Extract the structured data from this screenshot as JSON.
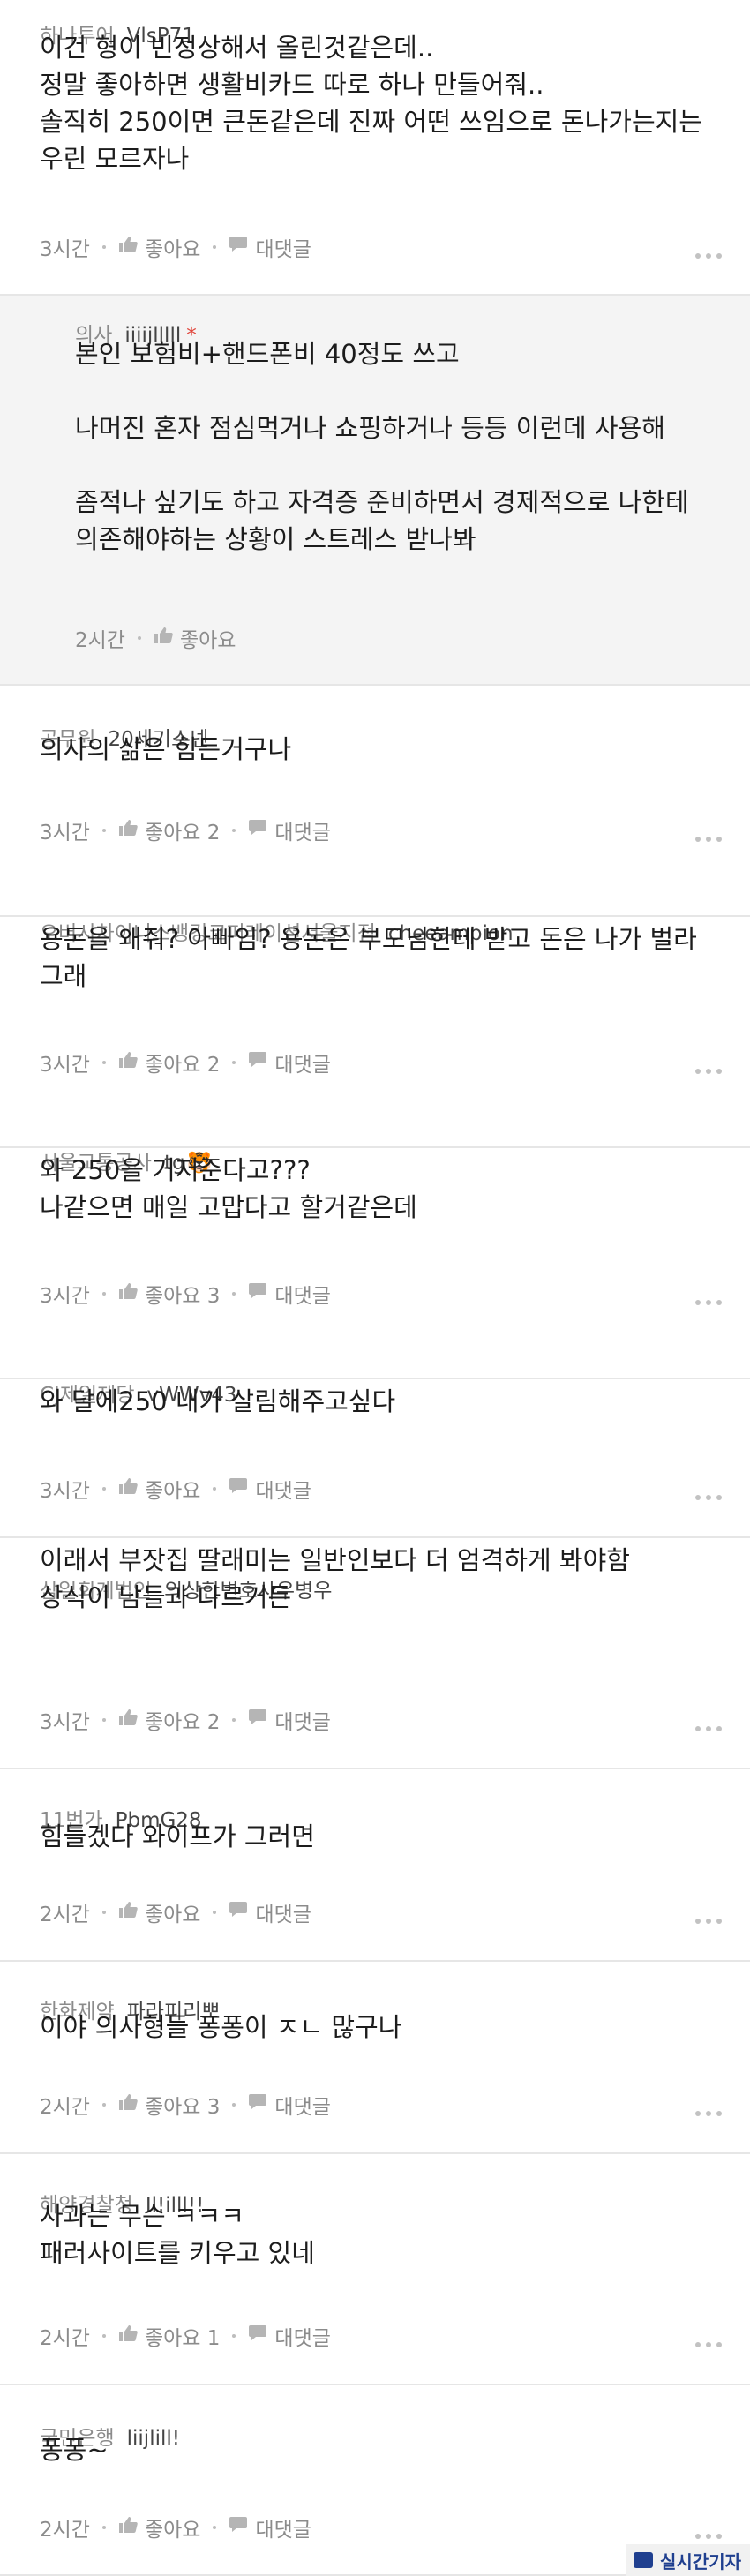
{
  "comments": [
    {
      "org": "하나투어",
      "nick": "VlsP71",
      "lines": [
        "이건 형이 빈정상해서 올린것같은데..",
        "정말 좋아하면 생활비카드 따로 하나 만들어줘..",
        "솔직히 250이면 큰돈같은데 진짜 어떤 쓰임으로 돈나가는지는",
        "우린 모르자나"
      ],
      "time": "3시간",
      "like": "좋아요",
      "reply": "대댓글"
    },
    {
      "org": "의사",
      "nick": "iiiijlllll",
      "star": "*",
      "lines": [
        "본인 보험비+핸드폰비 40정도 쓰고",
        "",
        "나머진 혼자 점심먹거나 쇼핑하거나 등등 이런데 사용해",
        "",
        "좀적나 싶기도 하고 자격증 준비하면서 경제적으로 나한테",
        "의존해야하는 상황이 스트레스 받나봐"
      ],
      "time": "2시간",
      "like": "좋아요"
    },
    {
      "org": "공무원",
      "nick": "20세기소넨",
      "lines": [
        "의사의 삶은 힘든거구나"
      ],
      "time": "3시간",
      "like": "좋아요 2",
      "reply": "대댓글"
    },
    {
      "org": "오버시차이니스뱅킹코퍼레이션서울지점",
      "nick": "cheeampion",
      "lines": [
        "용돈을 왜줘? 아빠임? 용돈은 부모님한테 받고 돈은 나가 벌라",
        "그래"
      ],
      "time": "3시간",
      "like": "좋아요 2",
      "reply": "대댓글"
    },
    {
      "org": "서울교통공사",
      "nick": "tg",
      "flag": "🐯",
      "lines": [
        "와 250을 거저준다고???",
        "나같으면 매일 고맙다고 할거같은데"
      ],
      "time": "3시간",
      "like": "좋아요 3",
      "reply": "대댓글"
    },
    {
      "org": "CJ제일제당",
      "nick": "vWWv43",
      "lines": [
        "와 달에250 내가 살림해주고싶다"
      ],
      "time": "3시간",
      "like": "좋아요",
      "reply": "대댓글"
    },
    {
      "org": "삼일회계법인",
      "nick": "의상한변호사우병우",
      "lines": [
        "이래서 부잣집 딸래미는 일반인보다 더 엄격하게 봐야함",
        "상식이 남들과 다르거든"
      ],
      "time": "3시간",
      "like": "좋아요 2",
      "reply": "대댓글"
    },
    {
      "org": "11번가",
      "nick": "PbmG28",
      "lines": [
        "힘들겠다 와이프가 그러면"
      ],
      "time": "2시간",
      "like": "좋아요",
      "reply": "대댓글"
    },
    {
      "org": "한화제약",
      "nick": "파라피리뽀",
      "lines": [
        "이야 의사형들 퐁퐁이 ㅈㄴ 많구나"
      ],
      "time": "2시간",
      "like": "좋아요 3",
      "reply": "대댓글"
    },
    {
      "org": "해양경찰청",
      "nick": "Il!illl!!",
      "lines": [
        "사과는 무슨 ㅋㅋㅋ",
        "패러사이트를 키우고 있네"
      ],
      "time": "2시간",
      "like": "좋아요 1",
      "reply": "대댓글"
    },
    {
      "org": "국민은행",
      "nick": "liijlill!",
      "lines": [
        "퐁퐁~"
      ],
      "time": "2시간",
      "like": "좋아요",
      "reply": "대댓글"
    }
  ],
  "watermark": "실시간기자"
}
